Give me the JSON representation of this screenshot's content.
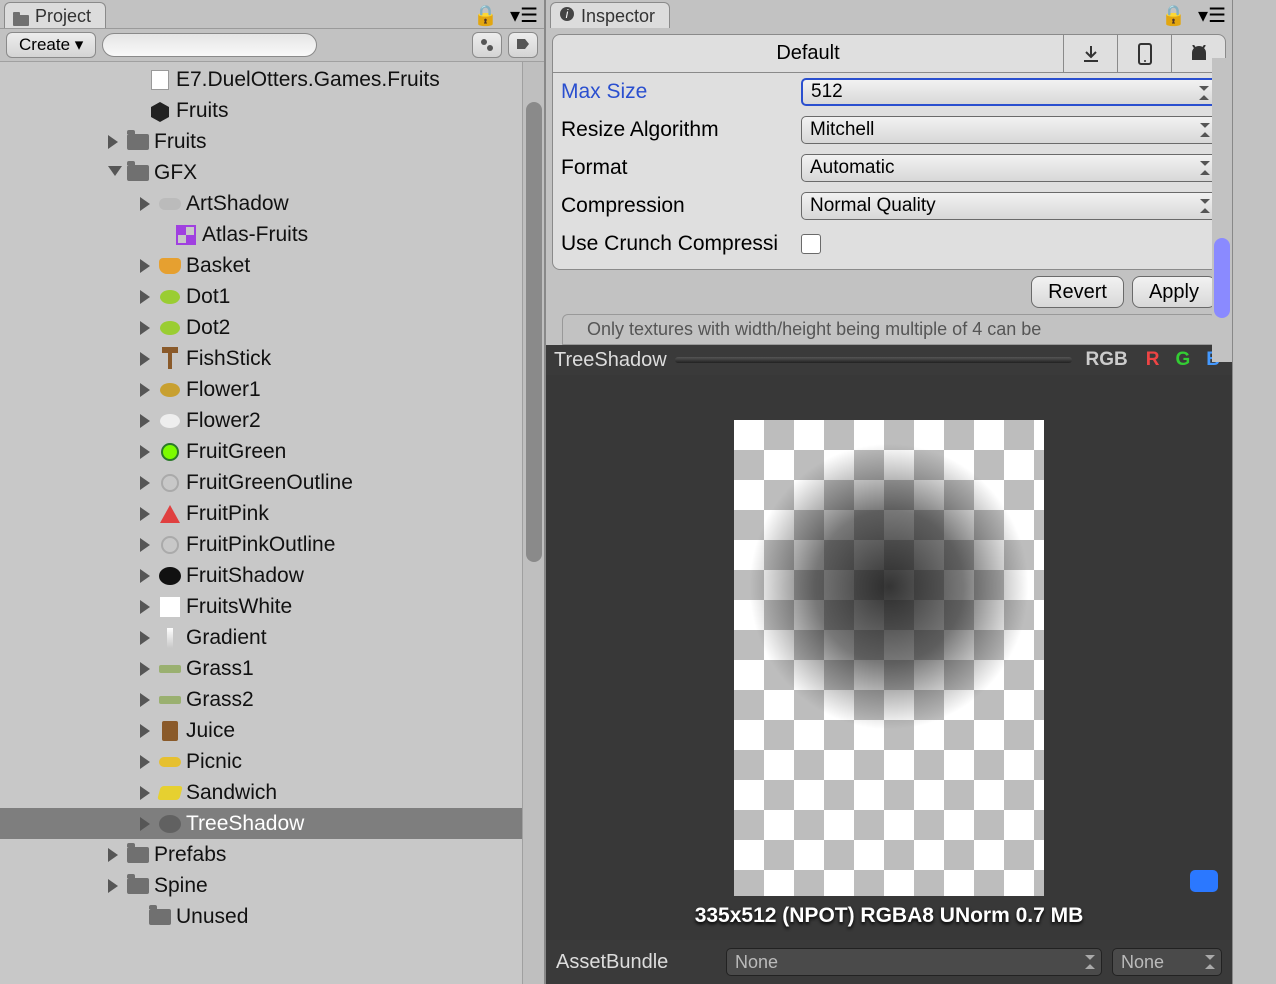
{
  "project": {
    "tab_label": "Project",
    "create_label": "Create  ▾",
    "search_placeholder": "",
    "items": [
      {
        "pad": 130,
        "tri": "",
        "icon": "file",
        "label": "E7.DuelOtters.Games.Fruits"
      },
      {
        "pad": 130,
        "tri": "",
        "icon": "unity",
        "label": "Fruits"
      },
      {
        "pad": 108,
        "tri": "collapsed",
        "icon": "folder",
        "label": "Fruits"
      },
      {
        "pad": 108,
        "tri": "expanded",
        "icon": "folder",
        "label": "GFX"
      },
      {
        "pad": 140,
        "tri": "collapsed",
        "icon": "cloud",
        "label": "ArtShadow"
      },
      {
        "pad": 156,
        "tri": "",
        "icon": "atlas",
        "label": "Atlas-Fruits"
      },
      {
        "pad": 140,
        "tri": "collapsed",
        "icon": "basket",
        "label": "Basket"
      },
      {
        "pad": 140,
        "tri": "collapsed",
        "icon": "dot",
        "label": "Dot1"
      },
      {
        "pad": 140,
        "tri": "collapsed",
        "icon": "dot",
        "label": "Dot2"
      },
      {
        "pad": 140,
        "tri": "collapsed",
        "icon": "stick",
        "label": "FishStick"
      },
      {
        "pad": 140,
        "tri": "collapsed",
        "icon": "flower",
        "label": "Flower1"
      },
      {
        "pad": 140,
        "tri": "collapsed",
        "icon": "flower2",
        "label": "Flower2"
      },
      {
        "pad": 140,
        "tri": "collapsed",
        "icon": "fruitg",
        "label": "FruitGreen"
      },
      {
        "pad": 140,
        "tri": "collapsed",
        "icon": "outline",
        "label": "FruitGreenOutline"
      },
      {
        "pad": 140,
        "tri": "collapsed",
        "icon": "fruitp",
        "label": "FruitPink"
      },
      {
        "pad": 140,
        "tri": "collapsed",
        "icon": "outline",
        "label": "FruitPinkOutline"
      },
      {
        "pad": 140,
        "tri": "collapsed",
        "icon": "shadowblob",
        "label": "FruitShadow"
      },
      {
        "pad": 140,
        "tri": "collapsed",
        "icon": "white",
        "label": "FruitsWhite"
      },
      {
        "pad": 140,
        "tri": "collapsed",
        "icon": "gradient",
        "label": "Gradient"
      },
      {
        "pad": 140,
        "tri": "collapsed",
        "icon": "grass",
        "label": "Grass1"
      },
      {
        "pad": 140,
        "tri": "collapsed",
        "icon": "grass",
        "label": "Grass2"
      },
      {
        "pad": 140,
        "tri": "collapsed",
        "icon": "juice",
        "label": "Juice"
      },
      {
        "pad": 140,
        "tri": "collapsed",
        "icon": "picnic",
        "label": "Picnic"
      },
      {
        "pad": 140,
        "tri": "collapsed",
        "icon": "sandwich",
        "label": "Sandwich"
      },
      {
        "pad": 140,
        "tri": "collapsed",
        "icon": "treeshadow",
        "label": "TreeShadow",
        "selected": true
      },
      {
        "pad": 108,
        "tri": "collapsed",
        "icon": "folder",
        "label": "Prefabs"
      },
      {
        "pad": 108,
        "tri": "collapsed",
        "icon": "folder",
        "label": "Spine"
      },
      {
        "pad": 130,
        "tri": "",
        "icon": "folder",
        "label": "Unused"
      }
    ]
  },
  "inspector": {
    "tab_label": "Inspector",
    "platform_tab": "Default",
    "max_size_label": "Max Size",
    "max_size_value": "512",
    "resize_label": "Resize Algorithm",
    "resize_value": "Mitchell",
    "format_label": "Format",
    "format_value": "Automatic",
    "compression_label": "Compression",
    "compression_value": "Normal Quality",
    "crunch_label": "Use Crunch Compressi",
    "revert_label": "Revert",
    "apply_label": "Apply",
    "note": "Only textures with width/height being multiple of 4 can be",
    "preview_title": "TreeShadow",
    "rgb_label": "RGB",
    "r": "R",
    "g": "G",
    "b": "B",
    "preview_caption": "335x512 (NPOT)  RGBA8 UNorm   0.7 MB",
    "assetbundle_label": "AssetBundle",
    "assetbundle_value": "None",
    "assetbundle_variant": "None"
  }
}
